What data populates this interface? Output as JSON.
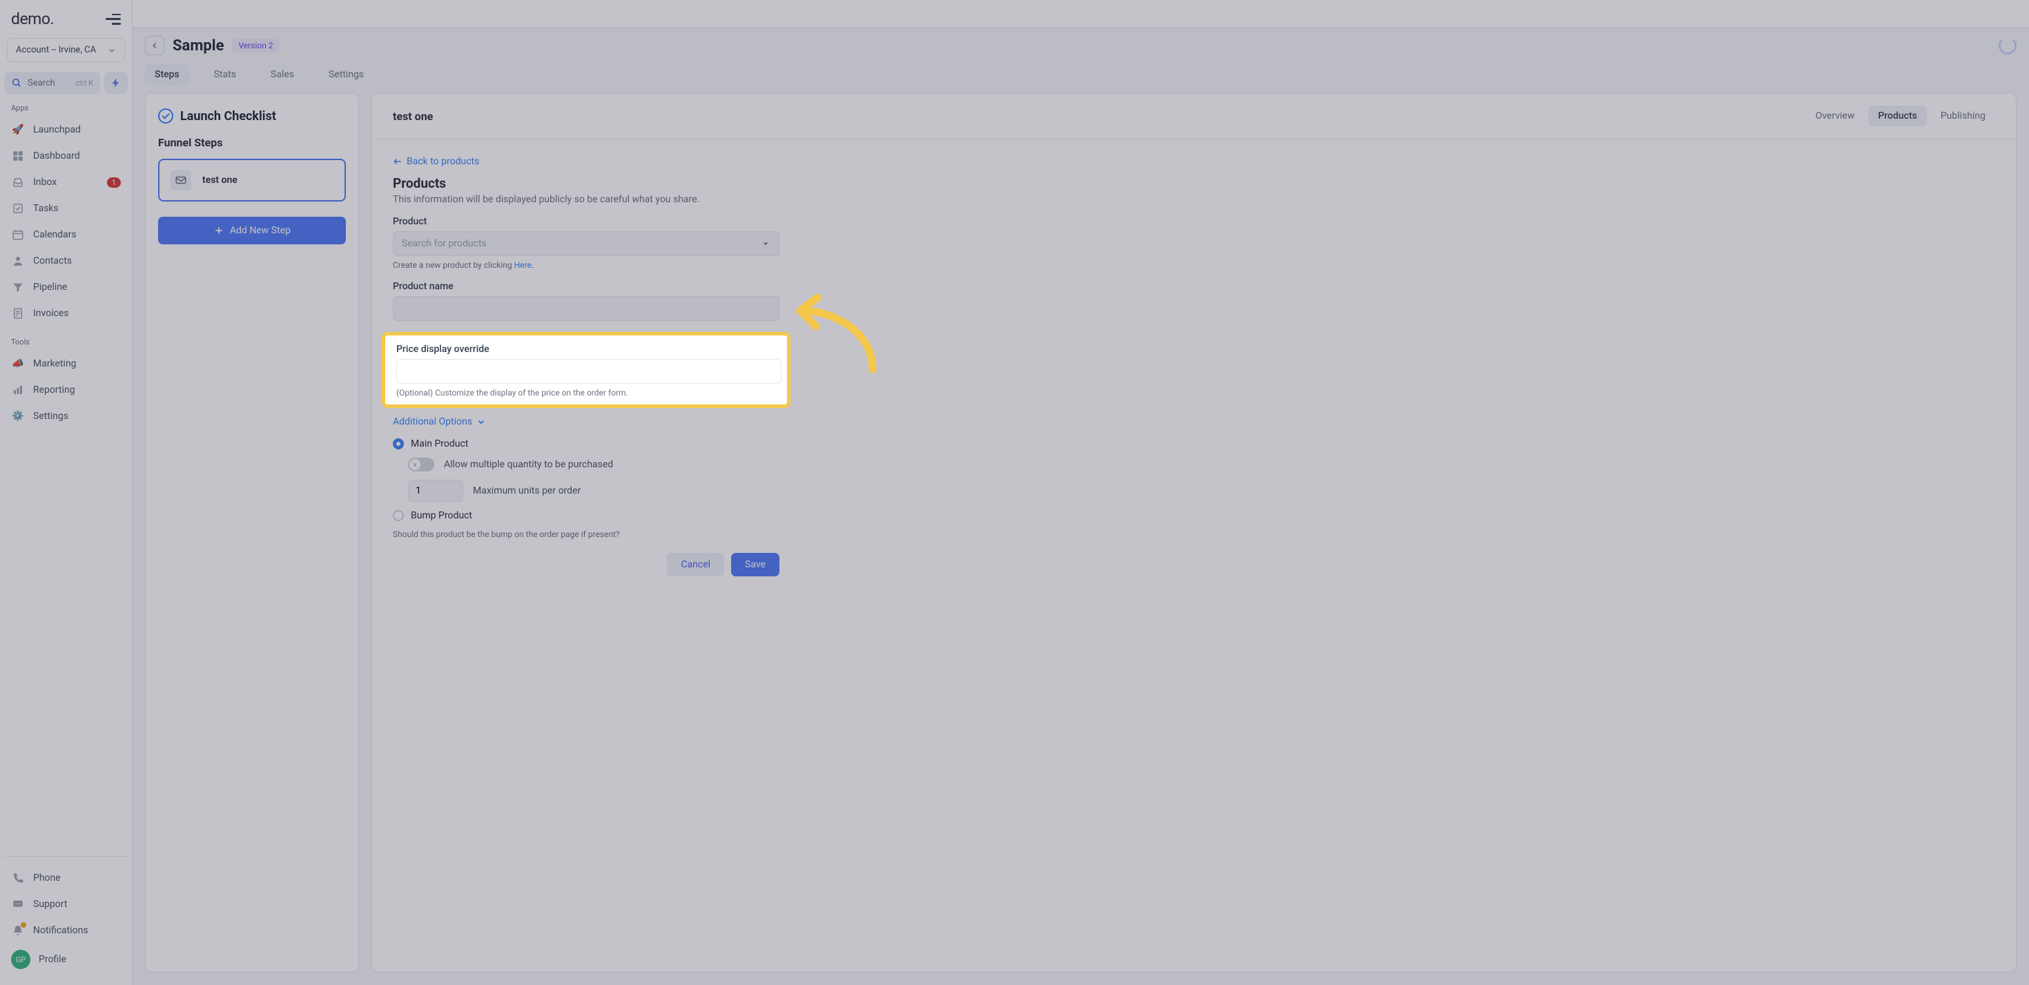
{
  "brand": "demo.",
  "account_selector": {
    "label": "Account -- Irvine, CA"
  },
  "search": {
    "label": "Search",
    "kbd": "ctrl K"
  },
  "side_sections": {
    "apps_label": "Apps",
    "tools_label": "Tools"
  },
  "nav_apps": {
    "launchpad": "Launchpad",
    "dashboard": "Dashboard",
    "inbox": "Inbox",
    "inbox_badge": "1",
    "tasks": "Tasks",
    "calendars": "Calendars",
    "contacts": "Contacts",
    "pipeline": "Pipeline",
    "invoices": "Invoices"
  },
  "nav_tools": {
    "marketing": "Marketing",
    "reporting": "Reporting",
    "settings": "Settings"
  },
  "nav_footer": {
    "phone": "Phone",
    "support": "Support",
    "notifications": "Notifications",
    "profile": "Profile",
    "avatar_initials": "GP"
  },
  "page": {
    "title": "Sample",
    "version": "Version 2"
  },
  "tabs": {
    "steps": "Steps",
    "stats": "Stats",
    "sales": "Sales",
    "settings": "Settings"
  },
  "left_panel": {
    "checklist": "Launch Checklist",
    "funnel_steps": "Funnel Steps",
    "step1": "test one",
    "add_step": "Add New Step"
  },
  "right_panel": {
    "title": "test one",
    "tabs": {
      "overview": "Overview",
      "products": "Products",
      "publishing": "Publishing"
    }
  },
  "form": {
    "back": "Back to products",
    "heading": "Products",
    "desc": "This information will be displayed publicly so be careful what you share.",
    "product_label": "Product",
    "product_placeholder": "Search for products",
    "product_helper_pre": "Create a new product by clicking ",
    "product_helper_link": "Here.",
    "name_label": "Product name",
    "price_override_label": "Price display override",
    "price_override_helper": "(Optional) Customize the display of the price on the order form.",
    "additional": "Additional Options",
    "main_product": "Main Product",
    "allow_multi": "Allow multiple quantity to be purchased",
    "max_units_value": "1",
    "max_units_label": "Maximum units per order",
    "bump_product": "Bump Product",
    "bump_helper": "Should this product be the bump on the order page if present?",
    "cancel": "Cancel",
    "save": "Save"
  }
}
